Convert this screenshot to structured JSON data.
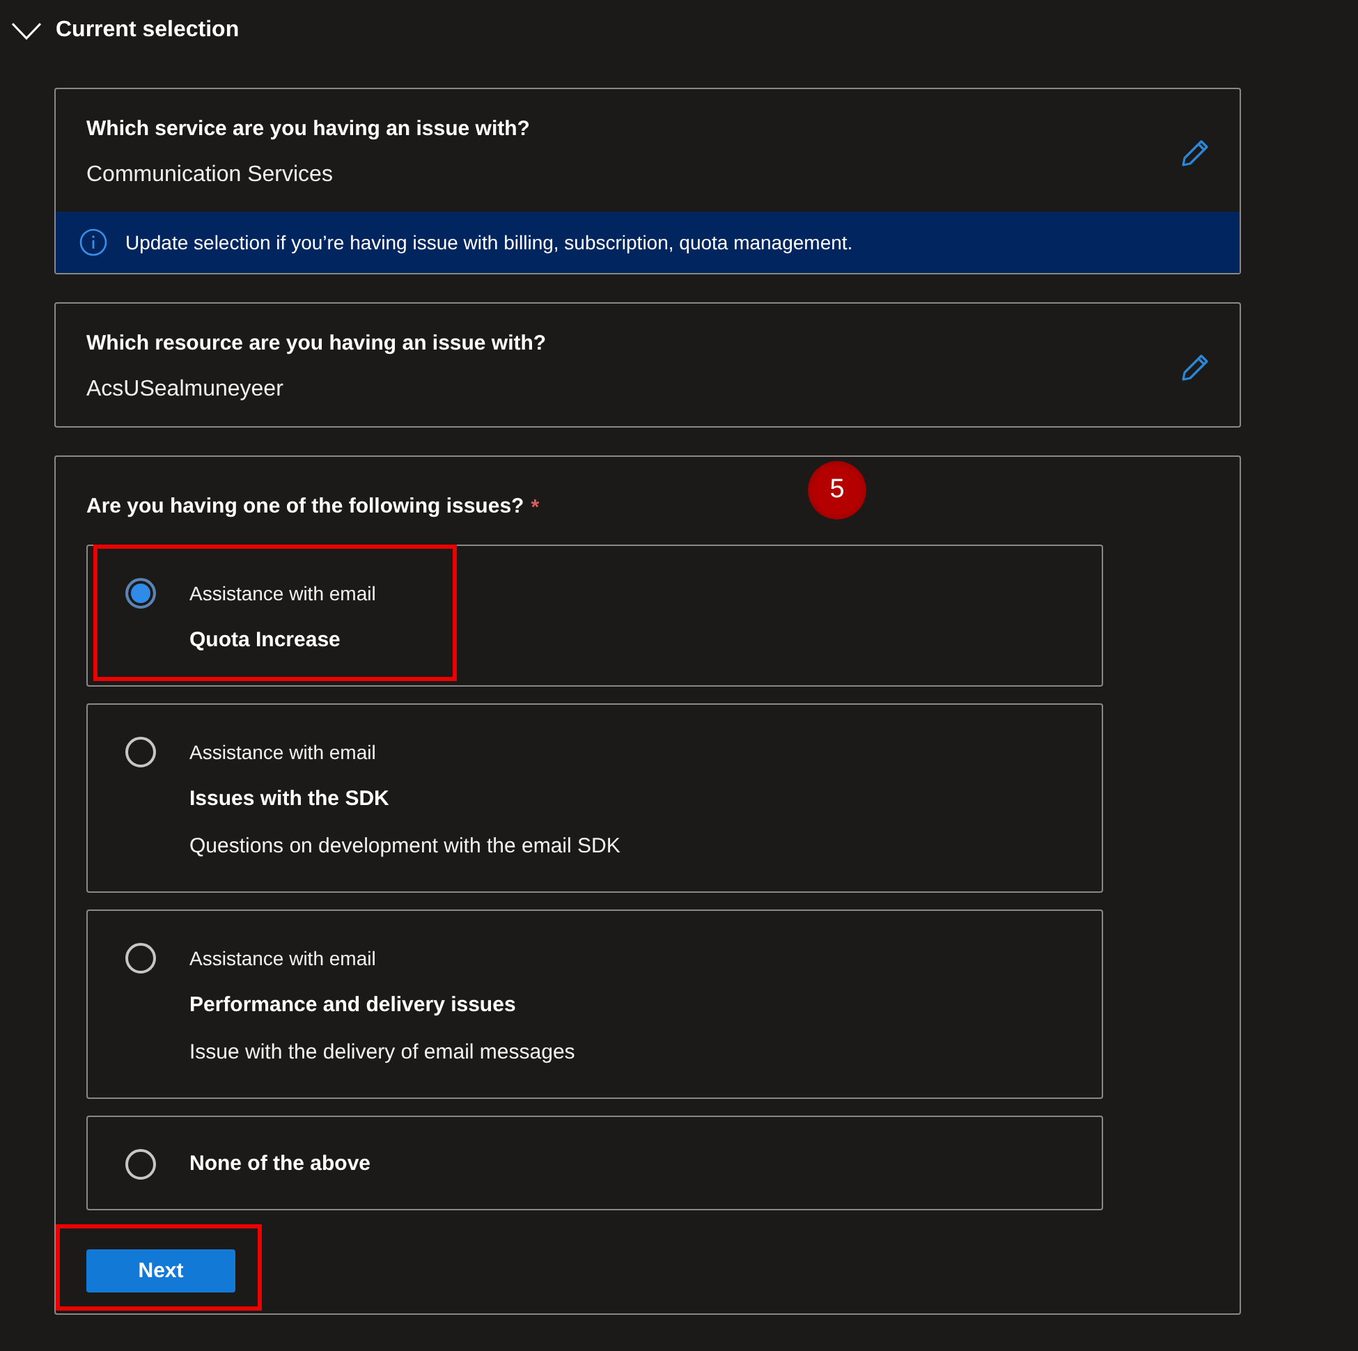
{
  "section": {
    "title": "Current selection",
    "expanded": true
  },
  "selections": [
    {
      "question": "Which service are you having an issue with?",
      "answer": "Communication Services",
      "info": "Update selection if you’re having issue with billing, subscription, quota management."
    },
    {
      "question": "Which resource are you having an issue with?",
      "answer": "AcsUSealmuneyeer"
    }
  ],
  "issues": {
    "question": "Are you having one of the following issues?",
    "required_mark": "*",
    "step_badge": "5",
    "options": [
      {
        "category": "Assistance with email",
        "title": "Quota Increase",
        "selected": true,
        "annotated": true
      },
      {
        "category": "Assistance with email",
        "title": "Issues with the SDK",
        "description": "Questions on development with the email SDK",
        "selected": false,
        "annotated": false
      },
      {
        "category": "Assistance with email",
        "title": "Performance and delivery issues",
        "description": "Issue with the delivery of email messages",
        "selected": false,
        "annotated": false
      },
      {
        "title": "None of the above",
        "selected": false,
        "annotated": false
      }
    ],
    "next_button": {
      "label": "Next",
      "annotated": true
    }
  }
}
